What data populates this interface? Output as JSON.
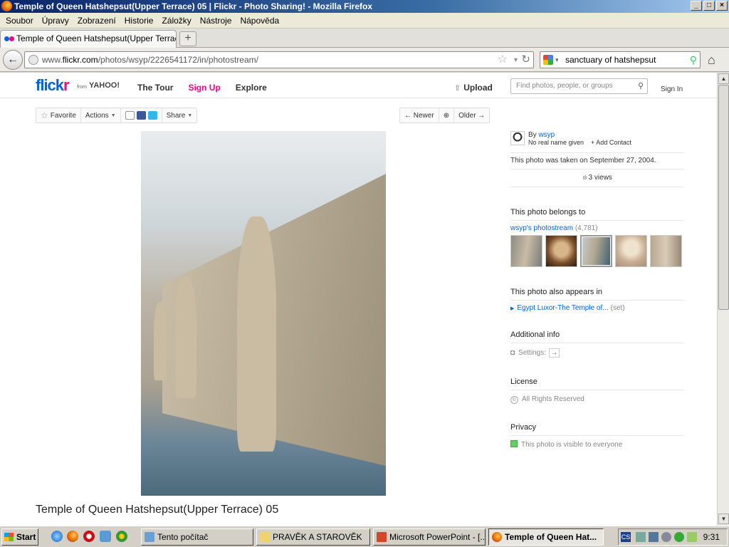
{
  "window": {
    "title": "Temple of Queen Hatshepsut(Upper Terrace) 05 | Flickr - Photo Sharing! - Mozilla Firefox",
    "minimize": "_",
    "maximize": "□",
    "close": "×"
  },
  "menu": [
    "Soubor",
    "Úpravy",
    "Zobrazení",
    "Historie",
    "Záložky",
    "Nástroje",
    "Nápověda"
  ],
  "tab": {
    "label": "Temple of Queen Hatshepsut(Upper Terrace...",
    "new_tab": "+"
  },
  "nav": {
    "back": "←",
    "url_prefix": "www.",
    "url_domain": "flickr.com",
    "url_path": "/photos/wsyp/2226541172/in/photostream/",
    "star": "☆",
    "dropdown": "▾",
    "reload": "↻",
    "search_value": "sanctuary of hatshepsut",
    "search_dropdown": "▾",
    "search_go": "⚲",
    "home": "⌂"
  },
  "flickr": {
    "logo_a": "flick",
    "logo_b": "r",
    "from": "from",
    "yahoo": "YAHOO!",
    "nav_tour": "The Tour",
    "nav_signup": "Sign Up",
    "nav_explore": "Explore",
    "upload_icon": "⇧",
    "upload": "Upload",
    "search_placeholder": "Find photos, people, or groups",
    "search_icon": "⚲",
    "signin": "Sign In"
  },
  "actions": {
    "favorite_icon": "☆",
    "favorite": "Favorite",
    "actions": "Actions",
    "share": "Share",
    "caret": "▼",
    "newer": "← Newer",
    "zoom": "⊕",
    "older": "Older →"
  },
  "photo": {
    "caption": "Temple of Queen Hatshepsut(Upper Terrace) 05"
  },
  "owner": {
    "by": "By ",
    "name": "wsyp",
    "no_name": "No real name given",
    "add_contact": "+ Add Contact"
  },
  "meta": {
    "taken": "This photo was taken on September 27, 2004.",
    "views_icon": "ıılı",
    "views": "3 views"
  },
  "belongs": {
    "heading": "This photo belongs to",
    "stream": "wsyp's photostream",
    "count": "(4,781)"
  },
  "appears": {
    "heading": "This photo also appears in",
    "tri": "▶",
    "set": "Egypt Luxor-The Temple of...",
    "set_label": "(set)"
  },
  "additional": {
    "heading": "Additional info",
    "cam": "◘",
    "settings": "Settings:",
    "arrow": "→"
  },
  "license": {
    "heading": "License",
    "cc": "©",
    "value": "All Rights Reserved"
  },
  "privacy": {
    "heading": "Privacy",
    "value": "This photo is visible to everyone"
  },
  "scroll": {
    "up": "▲",
    "down": "▼"
  },
  "taskbar": {
    "start": "Start",
    "items": [
      "Tento počítač",
      "PRAVĚK A STAROVĚK",
      "Microsoft PowerPoint - [...",
      "Temple of Queen Hat..."
    ],
    "clock": "9:31",
    "tray_label": "CS"
  }
}
